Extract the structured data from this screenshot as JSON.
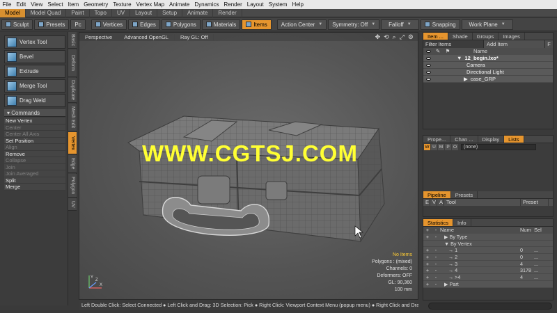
{
  "menu": [
    "File",
    "Edit",
    "View",
    "Select",
    "Item",
    "Geometry",
    "Texture",
    "Vertex Map",
    "Animate",
    "Dynamics",
    "Render",
    "Layout",
    "System",
    "Help"
  ],
  "layout_tabs": [
    {
      "label": "Model",
      "state": "orange"
    },
    {
      "label": "Model Quad",
      "state": "normal"
    },
    {
      "label": "Paint",
      "state": "normal"
    },
    {
      "label": "Topo",
      "state": "normal"
    },
    {
      "label": "UV",
      "state": "normal"
    },
    {
      "label": "Layout",
      "state": "normal"
    },
    {
      "label": "Setup",
      "state": "normal"
    },
    {
      "label": "Animate",
      "state": "normal"
    },
    {
      "label": "Render",
      "state": "normal"
    }
  ],
  "toolbar": {
    "sculpt": "Sculpt",
    "presets": "Presets",
    "pc": "Pc",
    "vertices": "Vertices",
    "edges": "Edges",
    "polygons": "Polygons",
    "materials": "Materials",
    "items": "Items",
    "action_center": "Action Center",
    "symmetry": "Symmetry: Off",
    "falloff": "Falloff",
    "snapping": "Snapping",
    "work_plane": "Work Plane"
  },
  "tools": [
    "Vertex Tool",
    "Bevel",
    "Extrude",
    "Merge Tool",
    "Drag Weld"
  ],
  "commands": {
    "title": "Commands",
    "items": [
      {
        "label": "New Vertex",
        "enabled": true
      },
      {
        "label": "Center",
        "enabled": false
      },
      {
        "label": "Center All Axis",
        "enabled": false
      },
      {
        "label": "Set Position",
        "enabled": true
      },
      {
        "label": "Align",
        "enabled": false
      },
      {
        "label": "Remove",
        "enabled": true
      },
      {
        "label": "Collapse",
        "enabled": false
      },
      {
        "label": "Join",
        "enabled": false
      },
      {
        "label": "Join Averaged",
        "enabled": false
      },
      {
        "label": "Split",
        "enabled": true
      },
      {
        "label": "Merge",
        "enabled": true
      }
    ]
  },
  "vtabs": [
    "Basic",
    "Deform",
    "Duplicate",
    "Mesh Edit",
    "Vertex",
    "Edge",
    "Polygon",
    "UV"
  ],
  "viewport": {
    "labels": [
      "Perspective",
      "Advanced OpenGL",
      "Ray GL: Off"
    ],
    "watermark": "WWW.CGTSJ.COM",
    "info": [
      "No Items",
      "Polygons : (mixed)",
      "Channels: 0",
      "Deformers: OFF",
      "GL: 90,360",
      "100 mm"
    ],
    "axis_labels": {
      "x": "X",
      "y": "Y",
      "z": "Z"
    }
  },
  "status_line": "Left Double Click: Select Connected ● Left Click and Drag: 3D Selection: Pick ● Right Click: Viewport Context Menu (popup menu) ● Right Click and Drag: 3D S...",
  "items_panel": {
    "tabs": [
      "Item ...",
      "Shade",
      "Groups",
      "Images"
    ],
    "filter": "Filter Items",
    "add_item": "Add Item",
    "f": "F",
    "col_name": "Name",
    "tree": [
      {
        "arrow": "▼",
        "name": "12_begin.lxo*",
        "bold": true,
        "indent": 0
      },
      {
        "arrow": "",
        "name": "Camera",
        "bold": false,
        "indent": 1
      },
      {
        "arrow": "",
        "name": "Directional Light",
        "bold": false,
        "indent": 1
      },
      {
        "arrow": "▶",
        "name": "case_GRP",
        "bold": false,
        "indent": 1
      }
    ]
  },
  "props_panel": {
    "tabs": [
      "Prope...",
      "Chan ...",
      "Display",
      "Lists"
    ],
    "letters": [
      "W",
      "U",
      "M",
      "P",
      "O"
    ],
    "selector": "(none)",
    "pipeline_tabs": [
      "Pipeline",
      "Presets"
    ],
    "pipeline_cols": [
      "E",
      "V",
      "A",
      "Tool",
      "Preset"
    ]
  },
  "stats_panel": {
    "tabs": [
      "Statistics",
      "Info"
    ],
    "cols": [
      "Name",
      "Num",
      "Sel"
    ],
    "rows": [
      {
        "a": "+",
        "b": "-",
        "name": "▶  By Type",
        "indent": 1,
        "num": "",
        "sel": ""
      },
      {
        "a": "",
        "b": "",
        "name": "▼  By Vertex",
        "indent": 1,
        "num": "",
        "sel": ""
      },
      {
        "a": "+",
        "b": "-",
        "name": "→   1",
        "indent": 2,
        "num": "0",
        "sel": "..."
      },
      {
        "a": "+",
        "b": "-",
        "name": "→   2",
        "indent": 2,
        "num": "0",
        "sel": "..."
      },
      {
        "a": "+",
        "b": "-",
        "name": "→   3",
        "indent": 2,
        "num": "4",
        "sel": "..."
      },
      {
        "a": "+",
        "b": "-",
        "name": "→   4",
        "indent": 2,
        "num": "3178",
        "sel": "..."
      },
      {
        "a": "+",
        "b": "-",
        "name": "→   >4",
        "indent": 2,
        "num": "4",
        "sel": "..."
      },
      {
        "a": "+",
        "b": "-",
        "name": "▶  Part",
        "indent": 1,
        "num": "",
        "sel": ""
      }
    ]
  }
}
